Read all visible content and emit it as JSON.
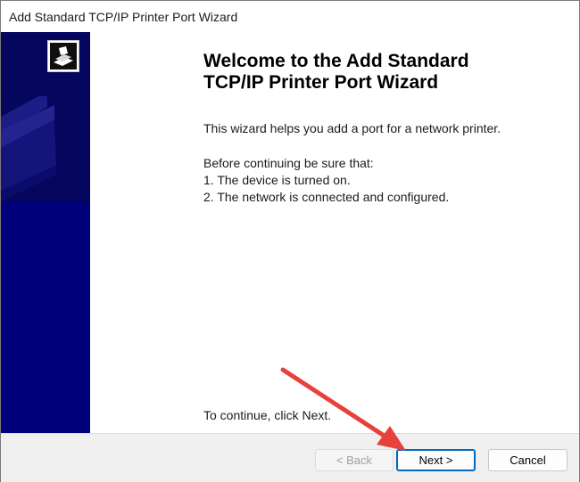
{
  "window": {
    "title": "Add Standard TCP/IP Printer Port Wizard"
  },
  "side_panel": {
    "logo_icon": "printer-wizard-icon",
    "background_color": "#00007a"
  },
  "content": {
    "heading_line1": "Welcome to the Add Standard",
    "heading_line2": "TCP/IP Printer Port Wizard",
    "intro": "This wizard helps you add a port for a network printer.",
    "before_label": "Before continuing be sure that:",
    "item1": "1.  The device is turned on.",
    "item2": "2.  The network is connected and configured.",
    "continue_text": "To continue, click Next."
  },
  "buttons": {
    "back": "< Back",
    "next": "Next >",
    "cancel": "Cancel"
  },
  "annotation": {
    "arrow_color": "#e8413c",
    "arrow_target": "next-button"
  }
}
